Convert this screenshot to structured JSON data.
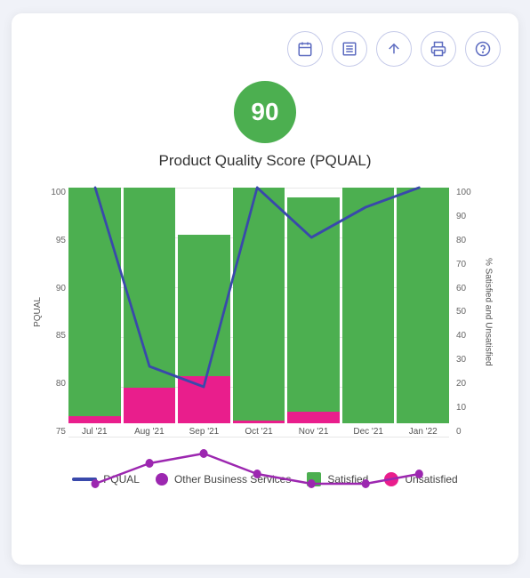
{
  "toolbar": {
    "buttons": [
      {
        "name": "calendar-button",
        "icon": "📅",
        "label": "Calendar"
      },
      {
        "name": "list-button",
        "icon": "📋",
        "label": "List"
      },
      {
        "name": "upload-button",
        "icon": "⬆",
        "label": "Upload"
      },
      {
        "name": "print-button",
        "icon": "🖨",
        "label": "Print"
      },
      {
        "name": "help-button",
        "icon": "?",
        "label": "Help"
      }
    ]
  },
  "score": {
    "value": "90",
    "label": "Product Quality Score (PQUAL)"
  },
  "chart": {
    "y_left_label": "PQUAL",
    "y_right_label": "% Satisfied and Unsatisfied",
    "y_left_ticks": [
      "100",
      "95",
      "90",
      "85",
      "80",
      "75"
    ],
    "y_right_ticks": [
      "100",
      "90",
      "80",
      "70",
      "60",
      "50",
      "40",
      "30",
      "20",
      "10",
      "0"
    ],
    "bars": [
      {
        "month": "Jul '21",
        "satisfied_pct": 100,
        "unsatisfied_pct": 3
      },
      {
        "month": "Aug '21",
        "satisfied_pct": 100,
        "unsatisfied_pct": 15
      },
      {
        "month": "Sep '21",
        "satisfied_pct": 80,
        "unsatisfied_pct": 20
      },
      {
        "month": "Oct '21",
        "satisfied_pct": 100,
        "unsatisfied_pct": 1
      },
      {
        "month": "Nov '21",
        "satisfied_pct": 95,
        "unsatisfied_pct": 5
      },
      {
        "month": "Dec '21",
        "satisfied_pct": 100,
        "unsatisfied_pct": 0
      },
      {
        "month": "Jan '22",
        "satisfied_pct": 100,
        "unsatisfied_pct": 0
      }
    ],
    "pqual_line": [
      100,
      82,
      80,
      100,
      95,
      98,
      100
    ],
    "other_line": [
      76,
      78,
      79,
      77,
      76,
      76,
      77
    ]
  },
  "legend": {
    "items": [
      {
        "key": "pqual",
        "label": "PQUAL",
        "type": "line",
        "color": "#3949ab"
      },
      {
        "key": "other",
        "label": "Other Business Services",
        "type": "dot",
        "color": "#9c27b0"
      },
      {
        "key": "satisfied",
        "label": "Satisfied",
        "type": "box",
        "color": "#4caf50"
      },
      {
        "key": "unsatisfied",
        "label": "Unsatisfied",
        "type": "box",
        "color": "#e91e8c"
      }
    ]
  }
}
